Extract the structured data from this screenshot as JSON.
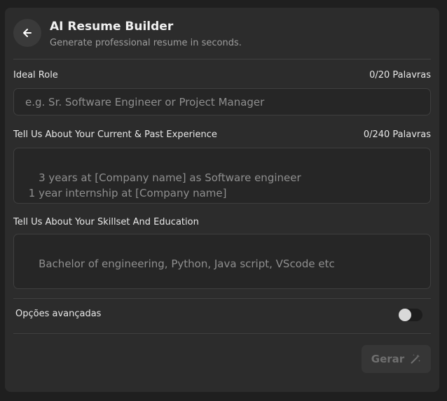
{
  "header": {
    "title": "AI Resume Builder",
    "subtitle": "Generate professional resume in seconds."
  },
  "role": {
    "label": "Ideal Role",
    "counter": "0/20 Palavras",
    "placeholder": "e.g. Sr. Software Engineer or Project Manager"
  },
  "experience": {
    "label": "Tell Us About Your Current & Past Experience",
    "counter": "0/240 Palavras",
    "placeholder": "3 years at [Company name] as Software engineer\n 1 year internship at [Company name]"
  },
  "skills": {
    "label": "Tell Us About Your Skillset And Education",
    "placeholder": "Bachelor of engineering, Python, Java script, VScode etc"
  },
  "advanced": {
    "label": "Opções avançadas",
    "enabled": false
  },
  "actions": {
    "generate_label": "Gerar"
  },
  "icons": {
    "back": "arrow-left-icon",
    "generate": "magic-wand-icon"
  },
  "colors": {
    "background": "#1f1f1f",
    "panel": "#2c2c2c",
    "field": "#262626"
  }
}
